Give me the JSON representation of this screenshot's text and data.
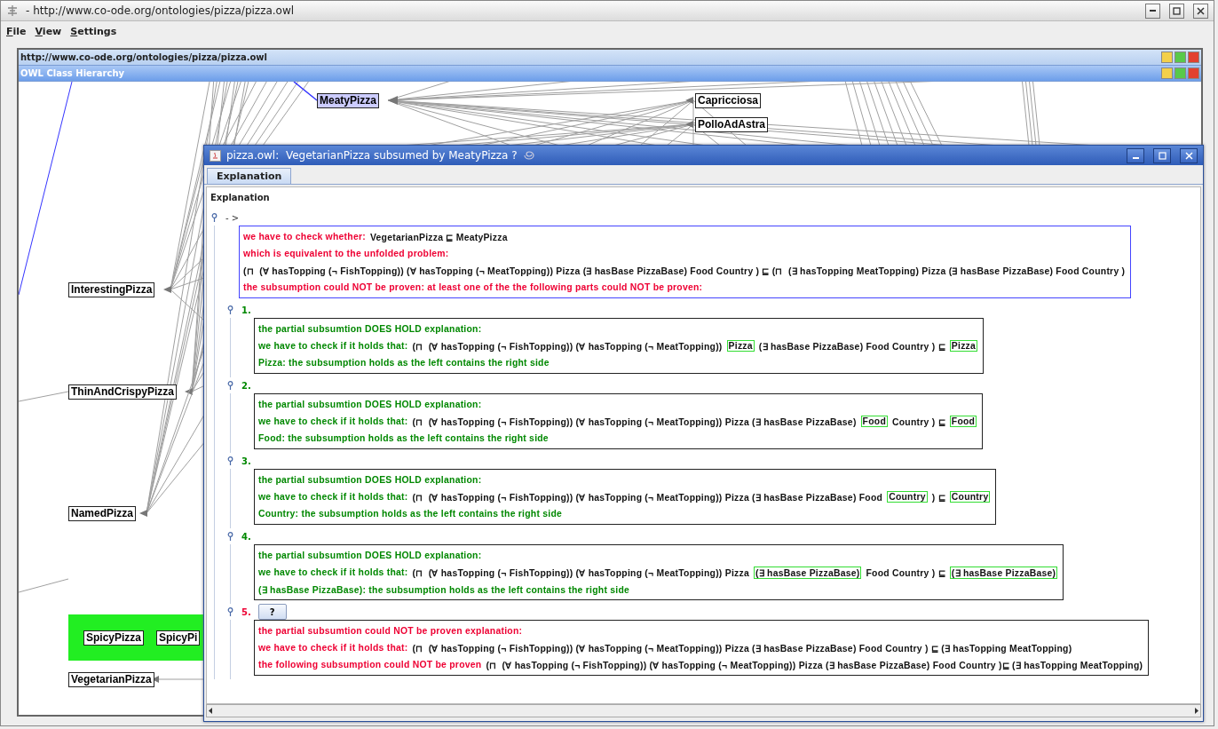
{
  "window": {
    "title": "- http://www.co-ode.org/ontologies/pizza/pizza.owl"
  },
  "menu": [
    "File",
    "View",
    "Settings"
  ],
  "ontology_frame": {
    "title": "http://www.co-ode.org/ontologies/pizza/pizza.owl"
  },
  "hierarchy_frame": {
    "title": "OWL Class Hierarchy"
  },
  "graph": {
    "nodes": [
      {
        "label": "MeatyPizza",
        "selected": true
      },
      {
        "label": "Capricciosa",
        "selected": false
      },
      {
        "label": "PolloAdAstra",
        "selected": false
      },
      {
        "label": "InterestingPizza",
        "selected": false
      },
      {
        "label": "ThinAndCrispyPizza",
        "selected": false
      },
      {
        "label": "NamedPizza",
        "selected": false
      },
      {
        "label": "VegetarianPizza",
        "selected": false
      }
    ],
    "highlight_group": {
      "nodes": [
        {
          "label": "SpicyPizza",
          "selected": false
        },
        {
          "label": "SpicyPi",
          "selected": false
        }
      ]
    }
  },
  "dialog": {
    "title": "pizza.owl:  VegetarianPizza subsumed by MeatyPizza ?",
    "tabs": [
      {
        "label": "Explanation",
        "selected": true
      }
    ],
    "heading": "Explanation",
    "root": {
      "label": "- >",
      "kind": "unproven",
      "lines": [
        [
          {
            "text": "we have to check whether:",
            "kind": "label",
            "boxed": false
          },
          {
            "text": "VegetarianPizza ⊑ MeatyPizza",
            "kind": "formula",
            "boxed": false
          }
        ],
        [
          {
            "text": "which is equivalent to the unfolded problem:",
            "kind": "label",
            "boxed": false
          }
        ],
        [
          {
            "text": "(⊓  (∀ hasTopping (¬ FishTopping)) (∀ hasTopping (¬ MeatTopping)) Pizza (∃ hasBase PizzaBase) Food Country ) ⊑ (⊓  (∃ hasTopping MeatTopping) Pizza (∃ hasBase PizzaBase) Food Country )",
            "kind": "formula",
            "boxed": false
          }
        ],
        [
          {
            "text": "the subsumption could NOT be proven: at least one of the the following parts could NOT be proven:",
            "kind": "label",
            "boxed": false
          }
        ]
      ]
    },
    "parts": [
      {
        "number": "1.",
        "kind": "holds",
        "lines": [
          [
            {
              "text": "the partial subsumtion DOES HOLD explanation:",
              "kind": "label",
              "boxed": false
            }
          ],
          [
            {
              "text": "we have to check if it holds that:",
              "kind": "label",
              "boxed": false
            },
            {
              "text": "(⊓  (∀ hasTopping (¬ FishTopping)) (∀ hasTopping (¬ MeatTopping))",
              "kind": "formula",
              "boxed": false
            },
            {
              "text": "Pizza",
              "kind": "formula",
              "boxed": true
            },
            {
              "text": "(∃ hasBase PizzaBase) Food Country ) ⊑",
              "kind": "formula",
              "boxed": false
            },
            {
              "text": "Pizza",
              "kind": "formula",
              "boxed": true
            }
          ],
          [
            {
              "text": "Pizza: the subsumption holds as the left contains the right side",
              "kind": "label",
              "boxed": false
            }
          ]
        ]
      },
      {
        "number": "2.",
        "kind": "holds",
        "lines": [
          [
            {
              "text": "the partial subsumtion DOES HOLD explanation:",
              "kind": "label",
              "boxed": false
            }
          ],
          [
            {
              "text": "we have to check if it holds that:",
              "kind": "label",
              "boxed": false
            },
            {
              "text": "(⊓  (∀ hasTopping (¬ FishTopping)) (∀ hasTopping (¬ MeatTopping)) Pizza (∃ hasBase PizzaBase)",
              "kind": "formula",
              "boxed": false
            },
            {
              "text": "Food",
              "kind": "formula",
              "boxed": true
            },
            {
              "text": "Country ) ⊑",
              "kind": "formula",
              "boxed": false
            },
            {
              "text": "Food",
              "kind": "formula",
              "boxed": true
            }
          ],
          [
            {
              "text": "Food: the subsumption holds as the left contains the right side",
              "kind": "label",
              "boxed": false
            }
          ]
        ]
      },
      {
        "number": "3.",
        "kind": "holds",
        "lines": [
          [
            {
              "text": "the partial subsumtion DOES HOLD explanation:",
              "kind": "label",
              "boxed": false
            }
          ],
          [
            {
              "text": "we have to check if it holds that:",
              "kind": "label",
              "boxed": false
            },
            {
              "text": "(⊓  (∀ hasTopping (¬ FishTopping)) (∀ hasTopping (¬ MeatTopping)) Pizza (∃ hasBase PizzaBase) Food",
              "kind": "formula",
              "boxed": false
            },
            {
              "text": "Country",
              "kind": "formula",
              "boxed": true
            },
            {
              "text": ") ⊑",
              "kind": "formula",
              "boxed": false
            },
            {
              "text": "Country",
              "kind": "formula",
              "boxed": true
            }
          ],
          [
            {
              "text": "Country: the subsumption holds as the left contains the right side",
              "kind": "label",
              "boxed": false
            }
          ]
        ]
      },
      {
        "number": "4.",
        "kind": "holds",
        "lines": [
          [
            {
              "text": "the partial subsumtion DOES HOLD explanation:",
              "kind": "label",
              "boxed": false
            }
          ],
          [
            {
              "text": "we have to check if it holds that:",
              "kind": "label",
              "boxed": false
            },
            {
              "text": "(⊓  (∀ hasTopping (¬ FishTopping)) (∀ hasTopping (¬ MeatTopping)) Pizza",
              "kind": "formula",
              "boxed": false
            },
            {
              "text": "(∃ hasBase PizzaBase)",
              "kind": "formula",
              "boxed": true
            },
            {
              "text": "Food Country ) ⊑",
              "kind": "formula",
              "boxed": false
            },
            {
              "text": "(∃ hasBase PizzaBase)",
              "kind": "formula",
              "boxed": true
            }
          ],
          [
            {
              "text": "(∃ hasBase PizzaBase): the subsumption holds as the left contains the right side",
              "kind": "label",
              "boxed": false
            }
          ]
        ]
      },
      {
        "number": "5.",
        "kind": "unproven",
        "button": "?",
        "lines": [
          [
            {
              "text": "the partial subsumtion could NOT be proven explanation:",
              "kind": "label",
              "boxed": false
            }
          ],
          [
            {
              "text": "we have to check if it holds that:",
              "kind": "label",
              "boxed": false
            },
            {
              "text": "(⊓  (∀ hasTopping (¬ FishTopping)) (∀ hasTopping (¬ MeatTopping)) Pizza (∃ hasBase PizzaBase) Food Country ) ⊑ (∃ hasTopping MeatTopping)",
              "kind": "formula",
              "boxed": false
            }
          ],
          [
            {
              "text": "the following subsumption could NOT be proven",
              "kind": "label",
              "boxed": false
            },
            {
              "text": "(⊓  (∀ hasTopping (¬ FishTopping)) (∀ hasTopping (¬ MeatTopping)) Pizza (∃ hasBase PizzaBase) Food Country )⊑ (∃ hasTopping MeatTopping)",
              "kind": "formula",
              "boxed": false
            }
          ]
        ]
      }
    ]
  }
}
